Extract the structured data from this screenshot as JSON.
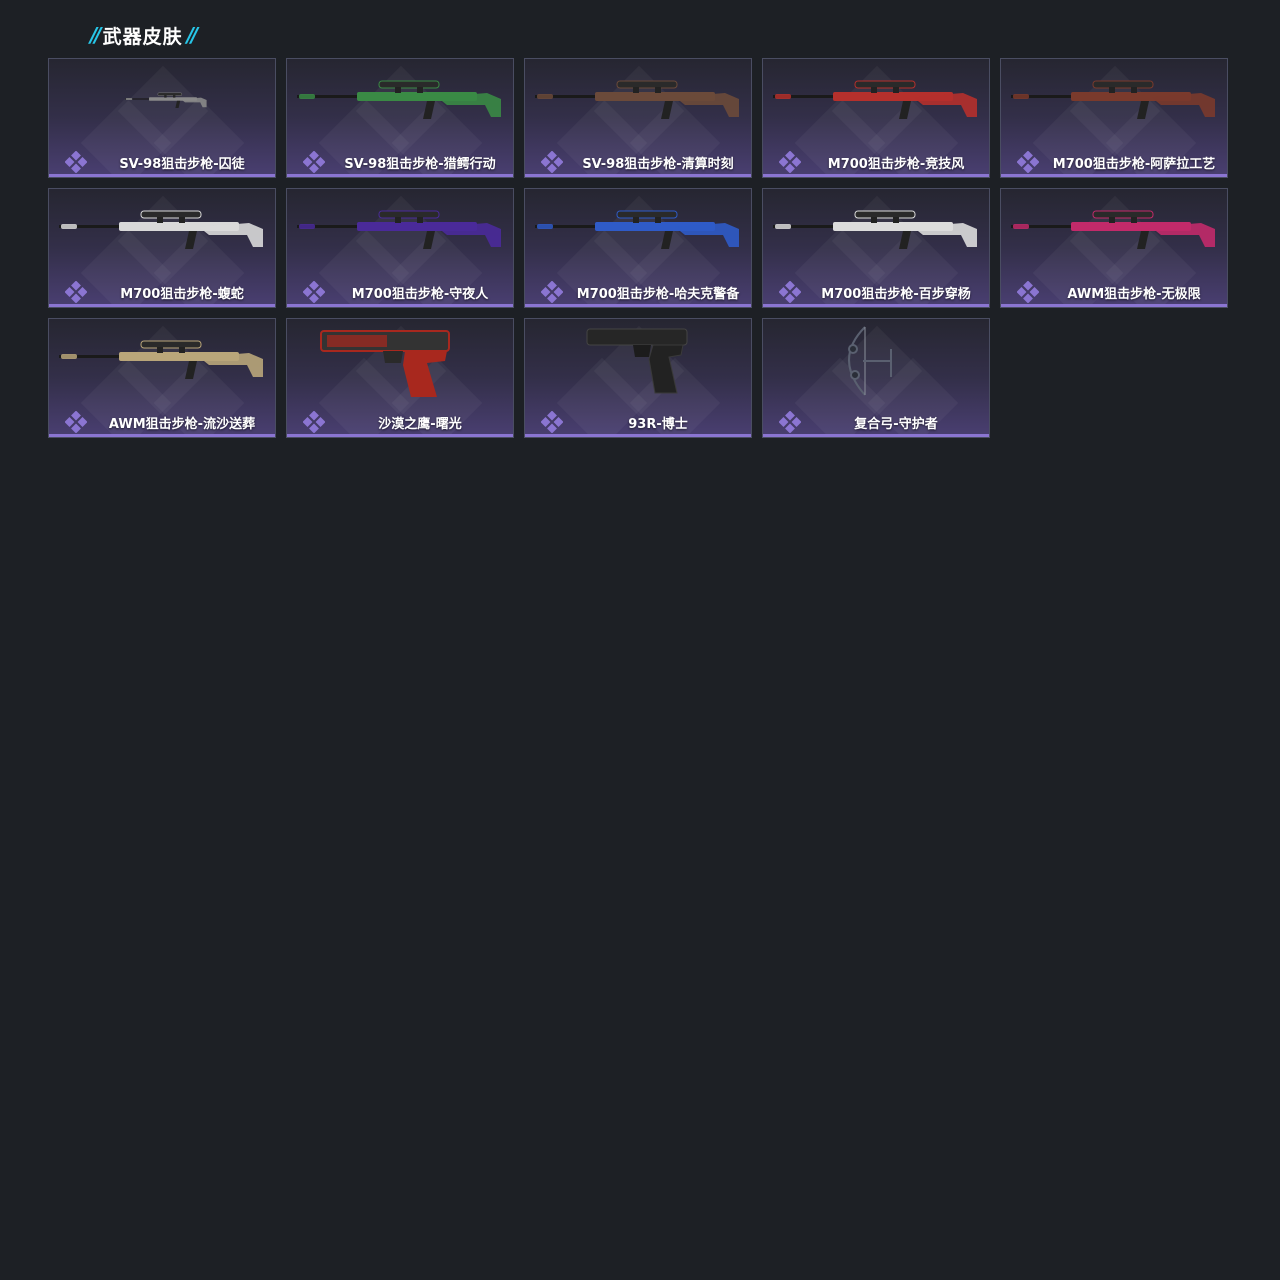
{
  "section": {
    "title": "武器皮肤",
    "slash_left": "//",
    "slash_right": "//"
  },
  "accent_color": "#27c6e8",
  "rarity_color": "#8b75d2",
  "skins": [
    {
      "label": "SV-98狙击步枪-囚徒",
      "icon": "sniper-rifle-icon",
      "color": "#8a8a8a",
      "type": "rifle-small"
    },
    {
      "label": "SV-98狙击步枪-猎鳄行动",
      "icon": "sniper-rifle-icon",
      "color": "#3a8a45",
      "type": "rifle"
    },
    {
      "label": "SV-98狙击步枪-清算时刻",
      "icon": "sniper-rifle-icon",
      "color": "#6b4a3a",
      "type": "rifle"
    },
    {
      "label": "M700狙击步枪-竞技风",
      "icon": "sniper-rifle-icon",
      "color": "#b5302c",
      "type": "rifle"
    },
    {
      "label": "M700狙击步枪-阿萨拉工艺",
      "icon": "sniper-rifle-icon",
      "color": "#7a3a2c",
      "type": "rifle"
    },
    {
      "label": "M700狙击步枪-蝮蛇",
      "icon": "sniper-rifle-icon",
      "color": "#d9d9d9",
      "type": "rifle"
    },
    {
      "label": "M700狙击步枪-守夜人",
      "icon": "sniper-rifle-icon",
      "color": "#4a2a9a",
      "type": "rifle"
    },
    {
      "label": "M700狙击步枪-哈夫克警备",
      "icon": "sniper-rifle-icon",
      "color": "#2f5bc8",
      "type": "rifle"
    },
    {
      "label": "M700狙击步枪-百步穿杨",
      "icon": "sniper-rifle-icon",
      "color": "#dcdcdc",
      "type": "rifle"
    },
    {
      "label": "AWM狙击步枪-无极限",
      "icon": "sniper-rifle-icon",
      "color": "#c22a6a",
      "type": "rifle"
    },
    {
      "label": "AWM狙击步枪-流沙送葬",
      "icon": "sniper-rifle-icon",
      "color": "#b9a67a",
      "type": "rifle"
    },
    {
      "label": "沙漠之鹰-曙光",
      "icon": "pistol-icon",
      "color": "#a8281e",
      "type": "pistol-big"
    },
    {
      "label": "93R-博士",
      "icon": "pistol-icon",
      "color": "#2a2a2a",
      "type": "pistol"
    },
    {
      "label": "复合弓-守护者",
      "icon": "compound-bow-icon",
      "color": "#5a6070",
      "type": "bow"
    }
  ]
}
